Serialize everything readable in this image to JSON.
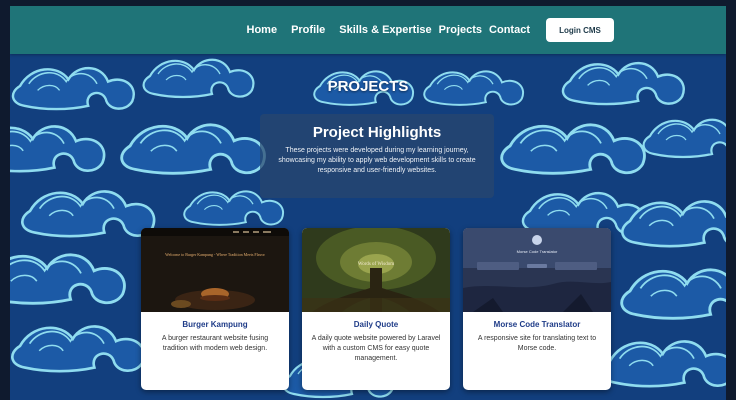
{
  "nav": {
    "links": [
      "Home",
      "Profile",
      "Skills & Expertise",
      "Projects",
      "Contact"
    ],
    "login_label": "Login CMS"
  },
  "section": {
    "title": "PROJECTS"
  },
  "highlights": {
    "title": "Project Highlights",
    "text": "These projects were developed during my learning journey, showcasing my ability to apply web development skills to create responsive and user-friendly websites."
  },
  "projects": [
    {
      "title": "Burger Kampung",
      "description": "A burger restaurant website fusing tradition with modern web design.",
      "thumb_caption": "Welcome to Burger Kampung - Where Tradition Meets Flavor"
    },
    {
      "title": "Daily Quote",
      "description": "A daily quote website powered by Laravel with a custom CMS for easy quote management.",
      "thumb_caption": "Words of Wisdom"
    },
    {
      "title": "Morse Code Translator",
      "description": "A responsive site for translating text to Morse code.",
      "thumb_caption": "Morse Code Translator"
    }
  ],
  "colors": {
    "navbar": "#1f7478",
    "background": "#123f7e",
    "pattern_stroke": "#7fd0e6",
    "card_title": "#1f3c88"
  }
}
